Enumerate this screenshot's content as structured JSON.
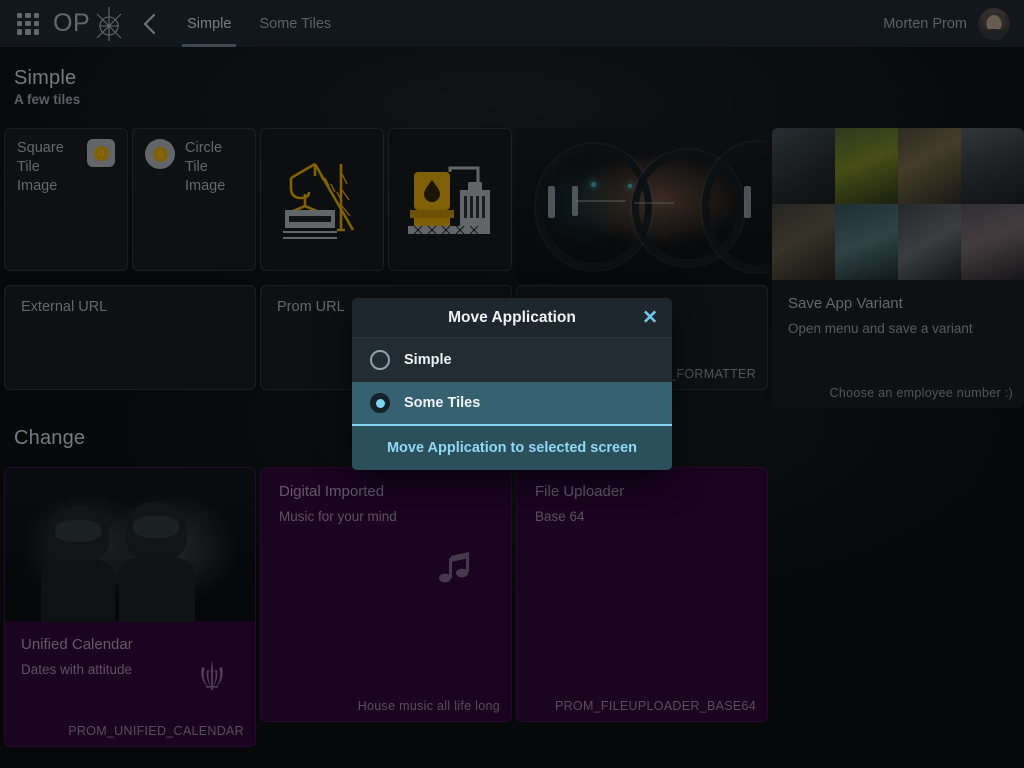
{
  "header": {
    "grid_icon": "apps-grid-icon",
    "logo_text": "OP",
    "logo_mark": "anchor-compass-logo-icon",
    "back_icon": "chevron-left-icon",
    "tabs": [
      {
        "label": "Simple",
        "active": true
      },
      {
        "label": "Some Tiles",
        "active": false
      }
    ],
    "user_name": "Morten Prom",
    "avatar": "user-avatar"
  },
  "groups": [
    {
      "title": "Simple",
      "subtitle": "A few tiles",
      "rows": [
        {
          "tiles": [
            {
              "kind": "kpi-square",
              "title": "Square Tile Image",
              "icon": "square-badge-icon"
            },
            {
              "kind": "kpi-circle",
              "title": "Circle Tile Image",
              "icon": "circle-badge-icon"
            },
            {
              "kind": "icon-crane",
              "icon": "crane-icon"
            },
            {
              "kind": "icon-refinery",
              "icon": "oil-refinery-icon"
            },
            {
              "kind": "image-scifi",
              "icon": "scifi-corridor-image"
            },
            {
              "kind": "image-bikes",
              "title": "Save App Variant",
              "sub": "Open menu and save a variant",
              "foot": "Choose an employee number :)"
            }
          ]
        },
        {
          "tiles": [
            {
              "kind": "plain",
              "title": "External URL"
            },
            {
              "kind": "plain",
              "title": "Prom URL"
            },
            {
              "kind": "formatter",
              "foot": "_FORMATTER",
              "icon": "chart-magnifier-icon"
            }
          ]
        }
      ]
    },
    {
      "title": "Change",
      "rows": [
        {
          "tiles": [
            {
              "kind": "purple-image",
              "title": "Unified Calendar",
              "sub": "Dates with attitude",
              "foot": "PROM_UNIFIED_CALENDAR",
              "icon": "jedi-order-icon"
            },
            {
              "kind": "purple",
              "title": "Digital Imported",
              "sub": "Music for your mind",
              "foot": "House music all life long",
              "icon": "music-note-icon"
            },
            {
              "kind": "purple",
              "title": "File Uploader",
              "sub": "Base 64",
              "foot": "PROM_FILEUPLOADER_BASE64"
            }
          ]
        }
      ]
    }
  ],
  "modal": {
    "title": "Move Application",
    "close_icon": "close-icon",
    "options": [
      {
        "label": "Simple",
        "selected": false
      },
      {
        "label": "Some Tiles",
        "selected": true
      }
    ],
    "action_label": "Move Application to selected screen"
  },
  "colors": {
    "header_bg": "#1d252c",
    "page_bg": "#0a0d0f",
    "tile_bg": "#16191c",
    "purple_tile": "#2a0733",
    "accent": "#7fd4ef",
    "modal_bg": "#1e272e",
    "selected_row": "#356170",
    "gold": "#c8960a"
  }
}
